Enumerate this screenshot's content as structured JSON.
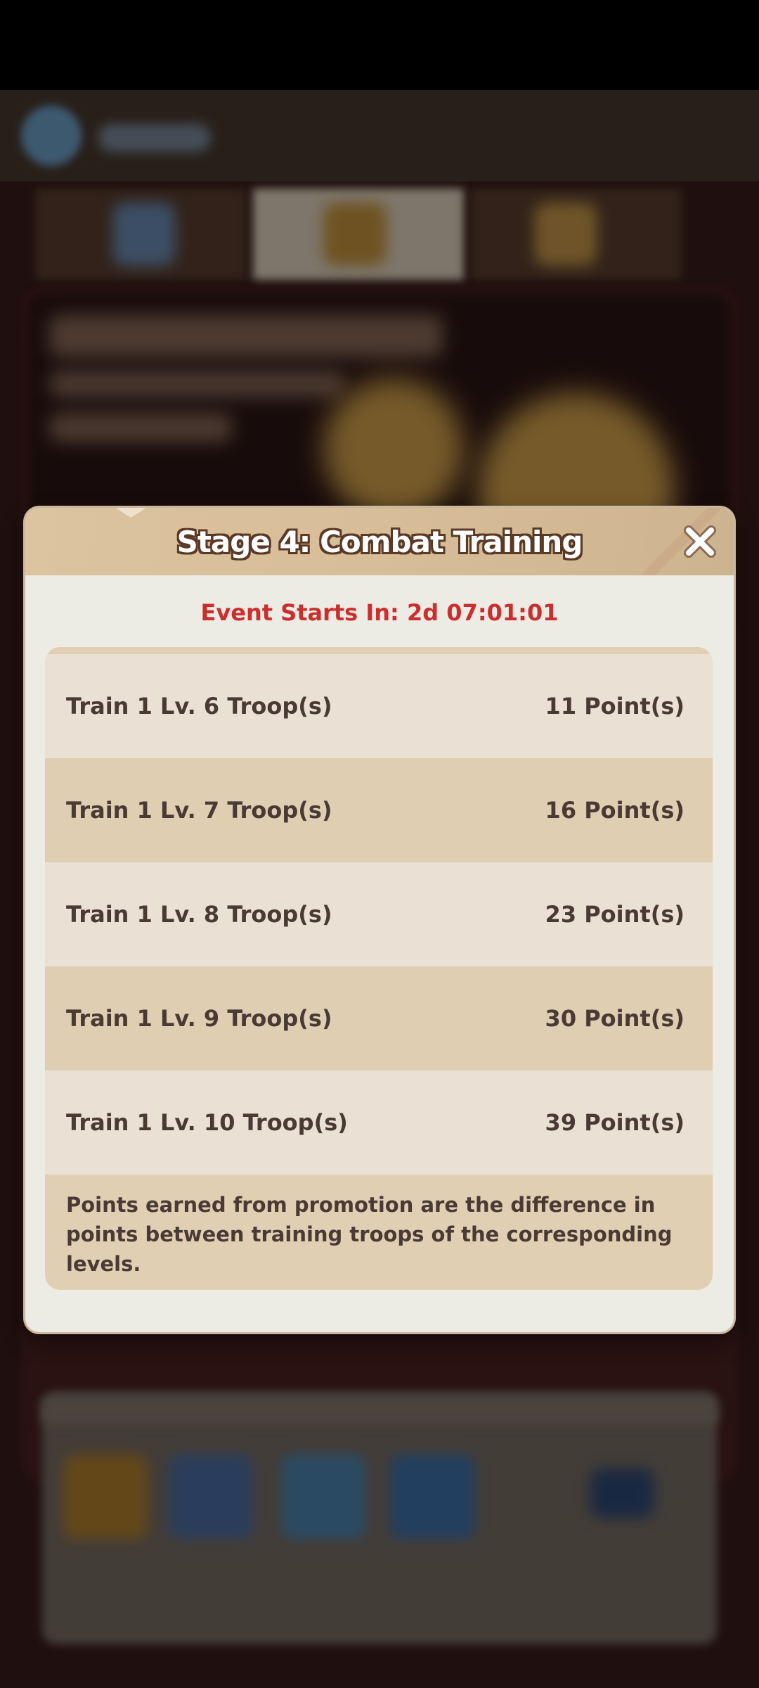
{
  "modal": {
    "title": "Stage 4: Combat Training",
    "countdown": "Event Starts In: 2d 07:01:01",
    "close_icon": "close-x-icon",
    "rows": [
      {
        "task": "Train 1 Lv. 6 Troop(s)",
        "points": "11 Point(s)"
      },
      {
        "task": "Train 1 Lv. 7 Troop(s)",
        "points": "16 Point(s)"
      },
      {
        "task": "Train 1 Lv. 8 Troop(s)",
        "points": "23 Point(s)"
      },
      {
        "task": "Train 1 Lv. 9 Troop(s)",
        "points": "30 Point(s)"
      },
      {
        "task": "Train 1 Lv. 10 Troop(s)",
        "points": "39 Point(s)"
      }
    ],
    "footnote": "Points earned from promotion are the difference in points between training troops of the corresponding levels."
  },
  "colors": {
    "countdown": "#cc2e2e",
    "header": "#dcc4a0",
    "row_light": "#eae0d3",
    "row_dark": "#dfceb2",
    "text": "#4a3a34"
  }
}
